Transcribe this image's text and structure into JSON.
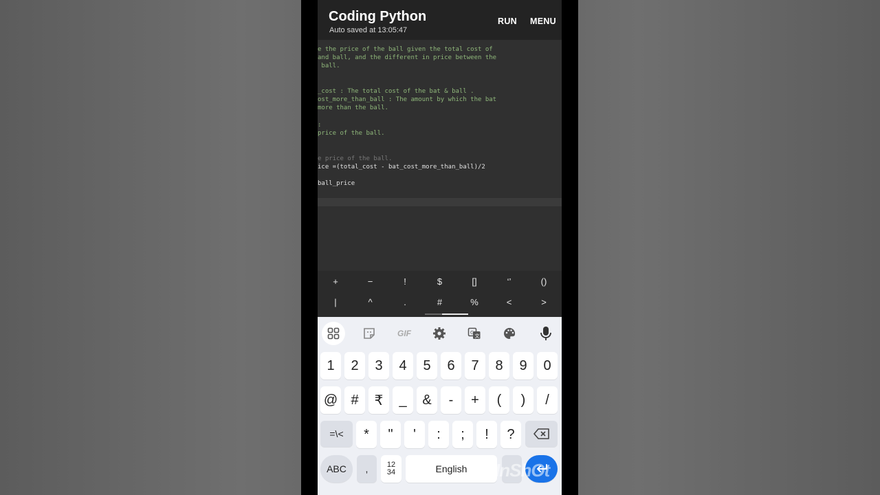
{
  "app": {
    "title": "Coding Python",
    "autosave": "Auto saved at 13:05:47",
    "run_label": "RUN",
    "menu_label": "MENU"
  },
  "code": {
    "lines": [
      {
        "text": "e the price of the ball given the total cost of",
        "kind": "doc"
      },
      {
        "text": "and ball, and the different in price between the",
        "kind": "doc"
      },
      {
        "text": " ball.",
        "kind": "doc"
      },
      {
        "text": "",
        "kind": "doc"
      },
      {
        "text": "",
        "kind": "doc"
      },
      {
        "text": "_cost : The total cost of the bat & ball .",
        "kind": "doc"
      },
      {
        "text": "ost_more_than_ball : The amount by which the bat",
        "kind": "doc"
      },
      {
        "text": "more than the ball.",
        "kind": "doc"
      },
      {
        "text": "",
        "kind": "doc"
      },
      {
        "text": ":",
        "kind": "doc"
      },
      {
        "text": "price of the ball.",
        "kind": "doc"
      },
      {
        "text": "",
        "kind": "doc"
      },
      {
        "text": "",
        "kind": "doc"
      },
      {
        "text": "e price of the ball.",
        "kind": "comment"
      },
      {
        "text": "ice =(total_cost - bat_cost_more_than_ball)/2",
        "kind": "code"
      },
      {
        "text": "",
        "kind": "code"
      },
      {
        "text": "ball_price",
        "kind": "code"
      }
    ]
  },
  "symbols": {
    "row1": [
      "+",
      "−",
      "!",
      "$",
      "[]",
      "‘’",
      "()"
    ],
    "row2": [
      "|",
      "^",
      ".",
      "#",
      "%",
      "<",
      ">"
    ]
  },
  "keyboard": {
    "toolbar": [
      "apps-icon",
      "sticker-icon",
      "gif-icon",
      "settings-icon",
      "translate-icon",
      "palette-icon",
      "mic-icon"
    ],
    "gif_label": "GIF",
    "row1": [
      "1",
      "2",
      "3",
      "4",
      "5",
      "6",
      "7",
      "8",
      "9",
      "0"
    ],
    "row2": [
      "@",
      "#",
      "₹",
      "_",
      "&",
      "-",
      "+",
      "(",
      ")",
      "/"
    ],
    "row3": [
      "*",
      "\"",
      "'",
      ":",
      ";",
      "!",
      "?"
    ],
    "more_symbols_label": "=\\<",
    "abc_label": "ABC",
    "comma_label": ",",
    "numpad_label": "12\n34",
    "space_label": "English"
  },
  "colors": {
    "topbar": "#232323",
    "editor_bg": "#303030",
    "docstring": "#8fb77a",
    "enter_key": "#1a73e8"
  }
}
